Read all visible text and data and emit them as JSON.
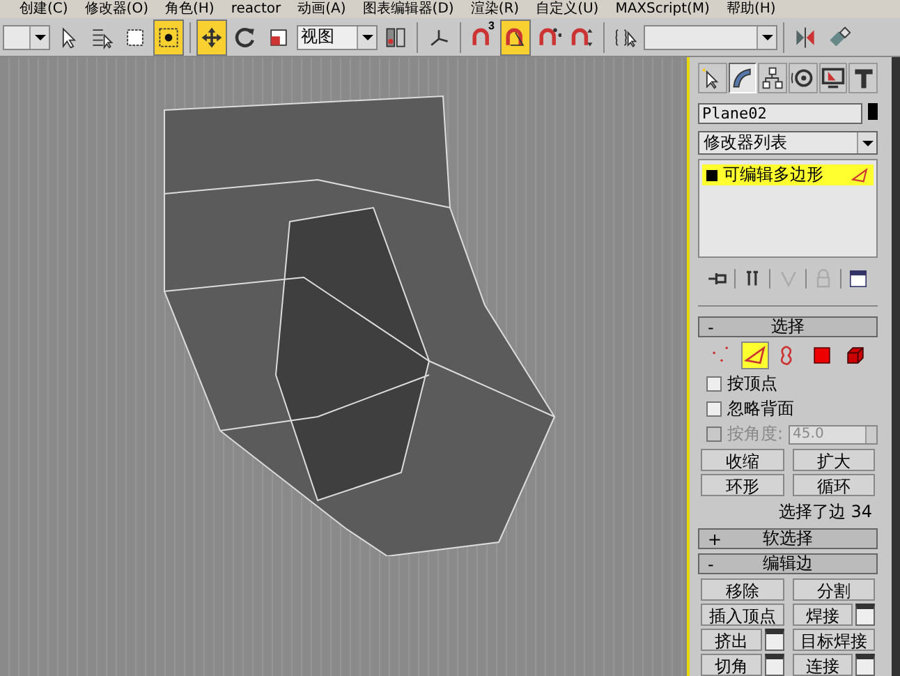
{
  "menu": [
    "创建(C)",
    "修改器(O)",
    "角色(H)",
    "reactor",
    "动画(A)",
    "图表编辑器(D)",
    "渲染(R)",
    "自定义(U)",
    "MAXScript(M)",
    "帮助(H)"
  ],
  "toolbar": [
    {
      "kind": "select"
    },
    {
      "kind": "icon",
      "selected": false
    },
    {
      "kind": "icon",
      "selected": false
    },
    {
      "kind": "icon",
      "selected": false
    },
    {
      "kind": "icon",
      "selected": true
    },
    {
      "kind": "sep"
    },
    {
      "kind": "icon",
      "selected": true
    },
    {
      "kind": "icon",
      "selected": false
    },
    {
      "kind": "icon",
      "selected": false
    },
    {
      "kind": "dropdown",
      "value": "视图"
    },
    {
      "kind": "icon",
      "selected": false
    },
    {
      "kind": "sep"
    },
    {
      "kind": "icon",
      "selected": false
    },
    {
      "kind": "sep"
    },
    {
      "kind": "icon",
      "selected": false,
      "badge": "3"
    },
    {
      "kind": "icon",
      "selected": true
    },
    {
      "kind": "icon",
      "selected": false
    },
    {
      "kind": "icon",
      "selected": false
    },
    {
      "kind": "sep"
    },
    {
      "kind": "icon",
      "selected": false
    },
    {
      "kind": "select"
    },
    {
      "kind": "sep"
    },
    {
      "kind": "icon",
      "selected": false
    },
    {
      "kind": "icon",
      "selected": false
    }
  ],
  "panel_tabs": [
    {
      "selected": false
    },
    {
      "selected": true
    },
    {
      "selected": false
    },
    {
      "selected": false
    },
    {
      "selected": false
    },
    {
      "selected": false
    }
  ],
  "object_name": "Plane02",
  "modifier_list": "修改器列表",
  "stack": [
    {
      "label": "可编辑多边形",
      "selected": true
    }
  ],
  "selection": {
    "sign": "-",
    "title": "选择",
    "levels": [
      {
        "selected": false
      },
      {
        "selected": true
      },
      {
        "selected": false
      },
      {
        "selected": false
      },
      {
        "selected": false
      }
    ],
    "options": [
      {
        "label": "按顶点",
        "checked": false,
        "disabled": false
      },
      {
        "label": "忽略背面",
        "checked": false,
        "disabled": false
      },
      {
        "label": "按角度:",
        "checked": false,
        "disabled": true,
        "value": "45.0"
      }
    ],
    "buttons": [
      "收缩",
      "扩大",
      "环形",
      "循环"
    ],
    "status": "选择了边 34"
  },
  "soft_selection": {
    "sign": "+",
    "title": "软选择"
  },
  "edit_edges": {
    "sign": "-",
    "title": "编辑边",
    "buttons": [
      {
        "label": "移除",
        "settings": false
      },
      {
        "label": "分割",
        "settings": false
      },
      {
        "label": "插入顶点",
        "settings": false
      },
      {
        "label": "焊接",
        "settings": true
      },
      {
        "label": "挤出",
        "settings": true
      },
      {
        "label": "目标焊接",
        "settings": false
      },
      {
        "label": "切角",
        "settings": true
      },
      {
        "label": "连接",
        "settings": true
      }
    ]
  }
}
